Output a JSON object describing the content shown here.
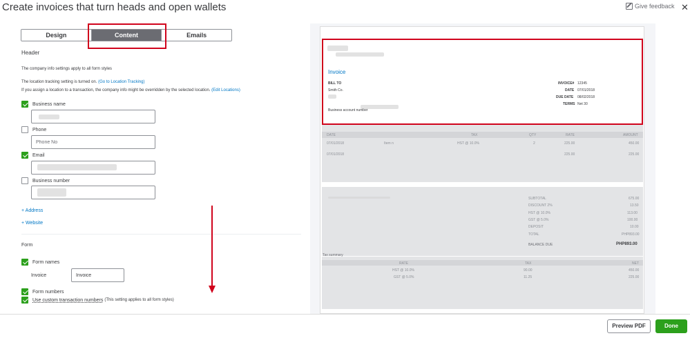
{
  "header": {
    "title": "Create invoices that turn heads and open wallets",
    "feedback_label": "Give feedback",
    "close_glyph": "✕"
  },
  "tabs": [
    {
      "label": "Design",
      "active": false
    },
    {
      "label": "Content",
      "active": true
    },
    {
      "label": "Emails",
      "active": false
    }
  ],
  "header_section": {
    "heading": "Header",
    "info_text": "The company info settings apply to all form styles",
    "location_text": "The location tracking setting is turned on.",
    "location_link": "(Go to Location Tracking)",
    "override_text": "If you assign a location to a transaction, the company info might be overridden by the selected location.",
    "override_link": "(Edit Locations)",
    "fields": [
      {
        "label": "Business name",
        "checked": true,
        "placeholder": "",
        "value": ""
      },
      {
        "label": "Phone",
        "checked": false,
        "placeholder": "Phone No",
        "value": ""
      },
      {
        "label": "Email",
        "checked": true,
        "placeholder": "",
        "value": ""
      },
      {
        "label": "Business number",
        "checked": false,
        "placeholder": "",
        "value": ""
      }
    ],
    "add_address": "+ Address",
    "add_website": "+ Website"
  },
  "form_section": {
    "heading": "Form",
    "form_names_label": "Form names",
    "form_names_checked": true,
    "invoice_label": "Invoice",
    "invoice_value": "Invoice",
    "form_numbers_label": "Form numbers",
    "form_numbers_checked": true,
    "custom_numbers_label": "Use custom transaction numbers",
    "custom_numbers_note": "(This setting applies to all form styles)",
    "custom_numbers_checked": true
  },
  "preview": {
    "invoice_title": "Invoice",
    "bill_to": "BILL TO",
    "customer": "Smith Co.",
    "business_account": "Business account number",
    "meta": [
      {
        "label": "INVOICE#",
        "value": "12345"
      },
      {
        "label": "DATE",
        "value": "07/01/2018"
      },
      {
        "label": "DUE DATE",
        "value": "08/02/2018"
      },
      {
        "label": "TERMS",
        "value": "Net 30"
      }
    ],
    "table_headers": [
      "DATE",
      "TAX",
      "QTY",
      "RATE",
      "AMOUNT"
    ],
    "rows": [
      {
        "date": "07/01/2018",
        "item": "Item n",
        "tax": "HST @ 10.0%",
        "qty": "2",
        "rate": "225.00",
        "amount": "450.00"
      },
      {
        "date": "07/01/2018",
        "item": "",
        "tax": "",
        "qty": "",
        "rate": "225.00",
        "amount": "225.00"
      }
    ],
    "totals": [
      {
        "label": "SUBTOTAL",
        "value": "675.00"
      },
      {
        "label": "DISCOUNT 2%",
        "value": "13.50"
      },
      {
        "label": "HST @ 10.0%",
        "value": "113.00"
      },
      {
        "label": "GST @ 5.0%",
        "value": "100.00"
      },
      {
        "label": "DEPOSIT",
        "value": "10.00"
      },
      {
        "label": "TOTAL",
        "value": "PHP893.00"
      }
    ],
    "balance_due_label": "BALANCE DUE",
    "balance_due_value": "PHP893.00",
    "tax_summary_label": "Tax summary",
    "tax_summary_headers": [
      "RATE",
      "TAX",
      "NET"
    ],
    "tax_summary_rows": [
      {
        "rate": "HST @ 10.0%",
        "tax": "90.00",
        "net": "450.00"
      },
      {
        "rate": "GST @ 5.0%",
        "tax": "11.25",
        "net": "225.00"
      }
    ]
  },
  "footer": {
    "preview_pdf": "Preview PDF",
    "done": "Done"
  },
  "colors": {
    "accent_green": "#2ca01c",
    "link_blue": "#0077c5",
    "highlight_red": "#d0021b"
  }
}
